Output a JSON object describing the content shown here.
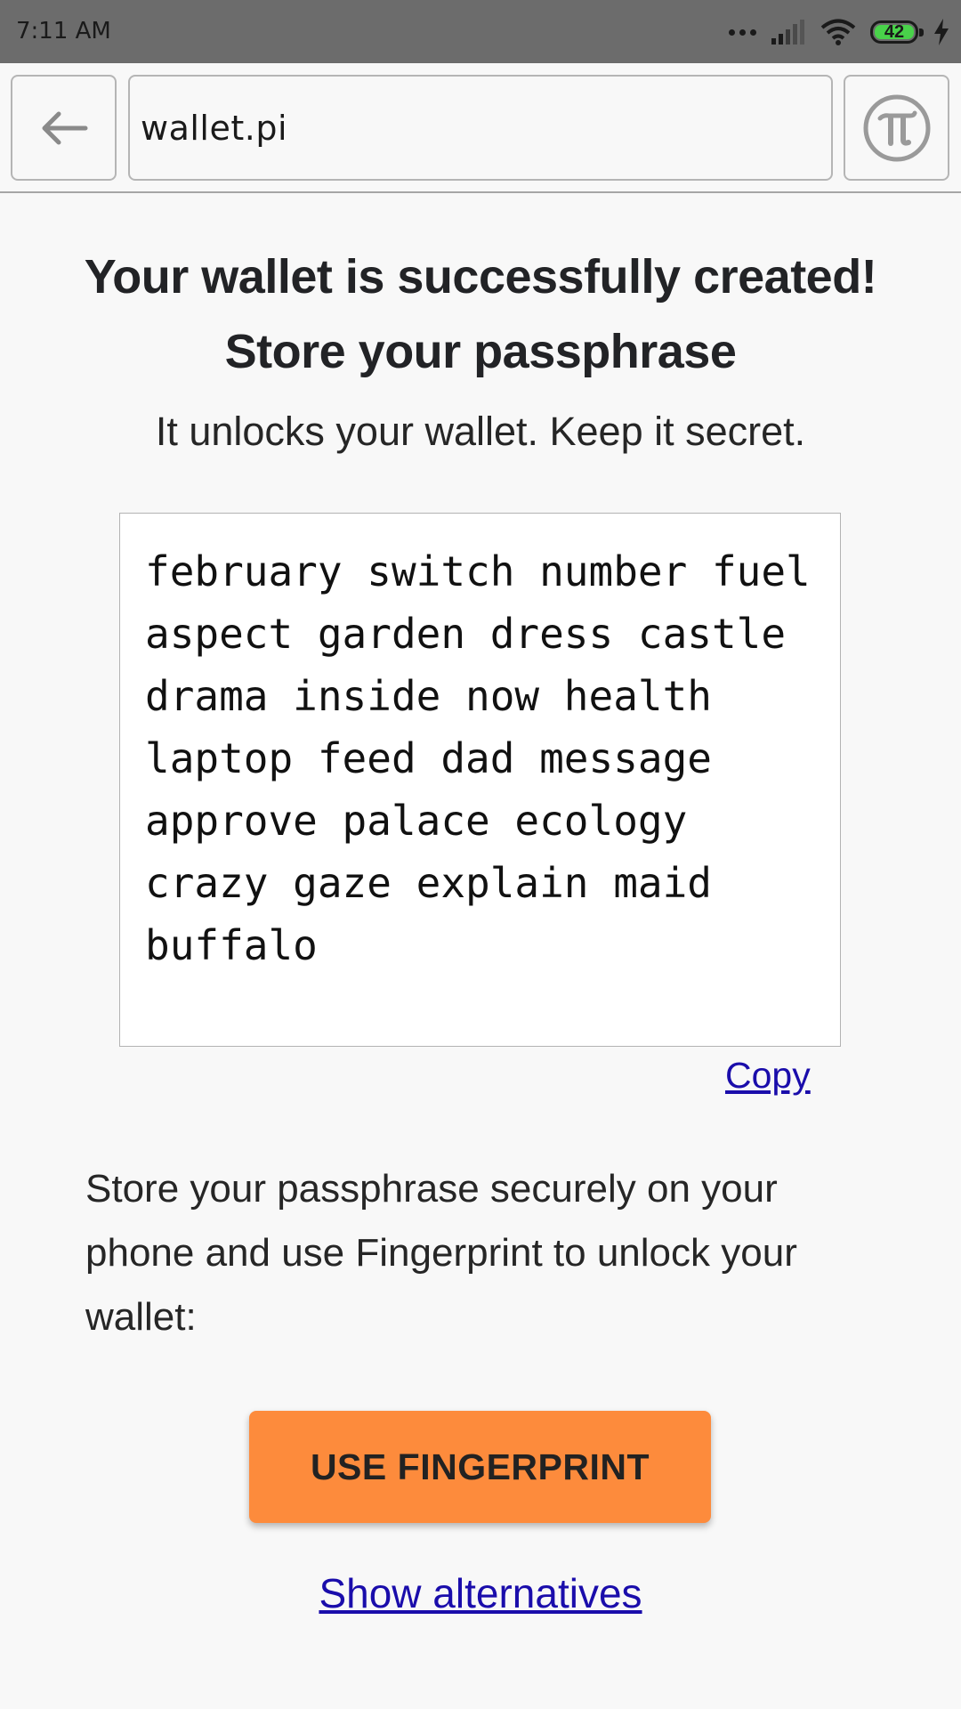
{
  "status_bar": {
    "time": "7:11 AM",
    "battery_level": "42"
  },
  "nav": {
    "url": "wallet.pi"
  },
  "main": {
    "title_line1": "Your wallet is successfully created!",
    "title_line2": "Store your passphrase",
    "subtitle": "It unlocks your wallet. Keep it secret.",
    "passphrase": "february switch number fuel aspect garden dress castle drama inside now health laptop feed dad message approve palace ecology crazy gaze explain maid buffalo",
    "copy_label": "Copy",
    "store_text": "Store your passphrase securely on your phone and use Fingerprint to unlock your wallet:",
    "fingerprint_button": "USE FINGERPRINT",
    "alternatives_link": "Show alternatives"
  },
  "colors": {
    "accent_button": "#fd8b3c",
    "link": "#1a0dab",
    "status_bar_bg": "#6c6c6c"
  },
  "icons": {
    "back": "arrow-left-icon",
    "pi_logo": "pi-logo-icon",
    "signal": "signal-icon",
    "wifi": "wifi-icon",
    "battery": "battery-icon",
    "charging": "charging-bolt-icon"
  }
}
